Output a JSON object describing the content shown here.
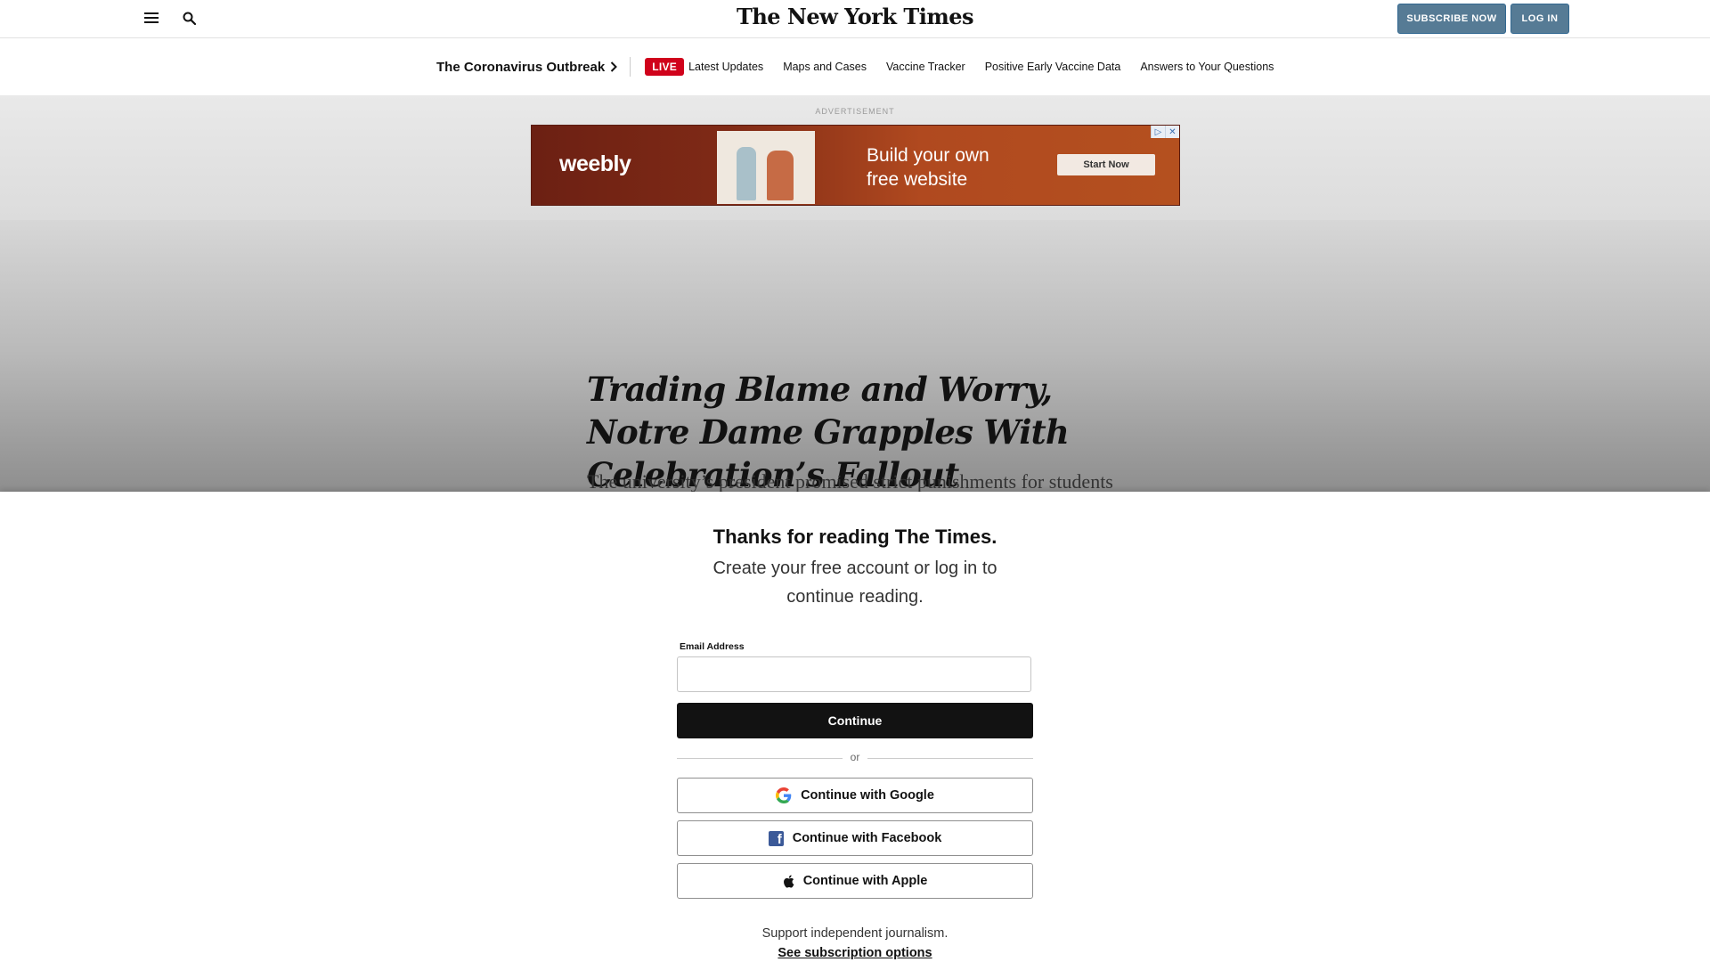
{
  "masthead": {
    "logo": "The New York Times",
    "subscribe_label": "SUBSCRIBE NOW",
    "login_label": "LOG IN",
    "menu_icon": "hamburger-icon",
    "search_icon": "search-icon",
    "button_color": "#567b95"
  },
  "section_nav": {
    "title": "The Coronavirus Outbreak",
    "live_label": "LIVE",
    "live_color": "#d0021b",
    "links": [
      "Latest Updates",
      "Maps and Cases",
      "Vaccine Tracker",
      "Positive Early Vaccine Data",
      "Answers to Your Questions"
    ]
  },
  "advertisement": {
    "label": "ADVERTISEMENT",
    "brand": "weebly",
    "headline_line1": "Build your own",
    "headline_line2": "free website",
    "cta": "Start Now"
  },
  "article": {
    "headline": "Trading Blame and Worry, Notre Dame Grapples With Celebration’s Fallout",
    "summary": "The university’s president promised strict punishments for students who break virus protocols. But his credibility on campus is wearing thin."
  },
  "gateway": {
    "title": "Thanks for reading The Times.",
    "subtitle": "Create your free account or log in to continue reading.",
    "email_label": "Email Address",
    "email_value": "",
    "continue_label": "Continue",
    "or_label": "or",
    "google_label": "Continue with Google",
    "facebook_label": "Continue with Facebook",
    "apple_label": "Continue with Apple",
    "support_text": "Support independent journalism.",
    "subscription_link": "See subscription options"
  }
}
